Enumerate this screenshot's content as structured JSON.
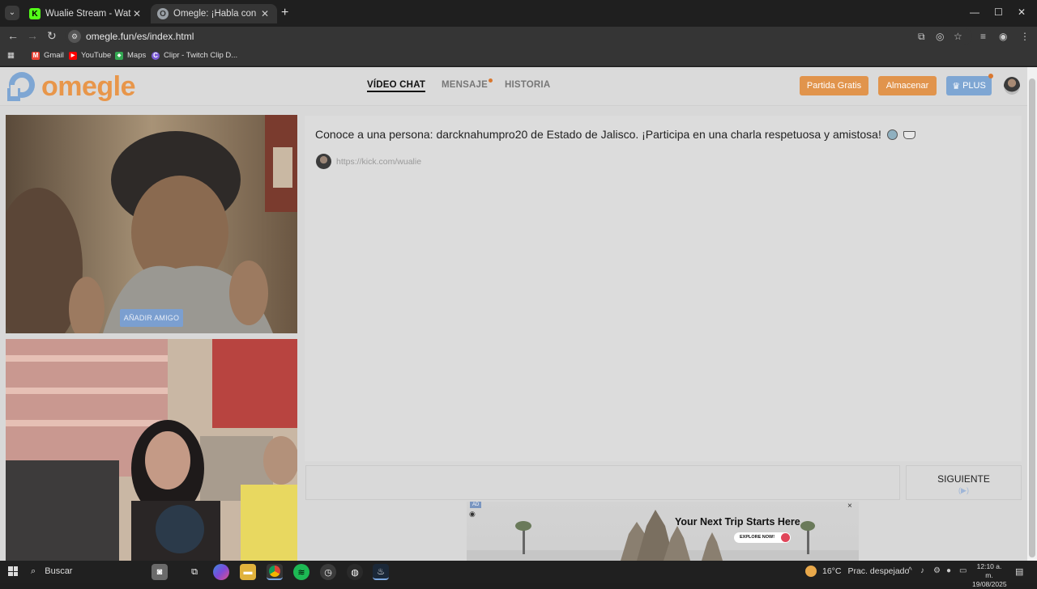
{
  "browser": {
    "tabs": [
      {
        "title": "Wualie Stream - Watch Live on",
        "icon": "kick-icon",
        "color": "#53fc18",
        "favtext": "K"
      },
      {
        "title": "Omegle: ¡Habla con Descon",
        "icon": "omegle-tab-icon",
        "color": "#9aa0a6",
        "favtext": "O"
      }
    ],
    "url": "omegle.fun/es/index.html",
    "bookmarks": [
      {
        "label": "Gmail",
        "color": "#ea4335",
        "glyph": "M"
      },
      {
        "label": "YouTube",
        "color": "#ff0000",
        "glyph": "▶"
      },
      {
        "label": "Maps",
        "color": "#34a853",
        "glyph": "◆"
      },
      {
        "label": "Clipr - Twitch Clip D...",
        "color": "#7b5bd6",
        "glyph": "C"
      }
    ]
  },
  "site": {
    "logo_text": "omegle",
    "nav": {
      "video_chat": "VÍDEO CHAT",
      "message": "MENSAJE",
      "history": "HISTORIA"
    },
    "buttons": {
      "free_game": "Partida Gratis",
      "store": "Almacenar",
      "plus": "PLUS"
    },
    "add_friend": "AÑADIR AMIGO",
    "chat": {
      "message": "Conoce a una persona: darcknahumpro20 de Estado de Jalisco. ¡Participa en una charla respetuosa y amistosa!",
      "link": "https://kick.com/wualie"
    },
    "next_label": "SIGUIENTE",
    "ad": {
      "tag": "AD",
      "headline": "Your Next Trip Starts Here",
      "cta": "EXPLORE NOW!",
      "close": "×"
    }
  },
  "taskbar": {
    "search": "Buscar",
    "weather_temp": "16°C",
    "weather_desc": "Prac. despejado",
    "time": "12:10 a. m.",
    "date": "19/08/2025"
  },
  "colors": {
    "accent_orange": "#e1944c",
    "accent_blue": "#7ea6d3",
    "logo": "#e8964a"
  }
}
